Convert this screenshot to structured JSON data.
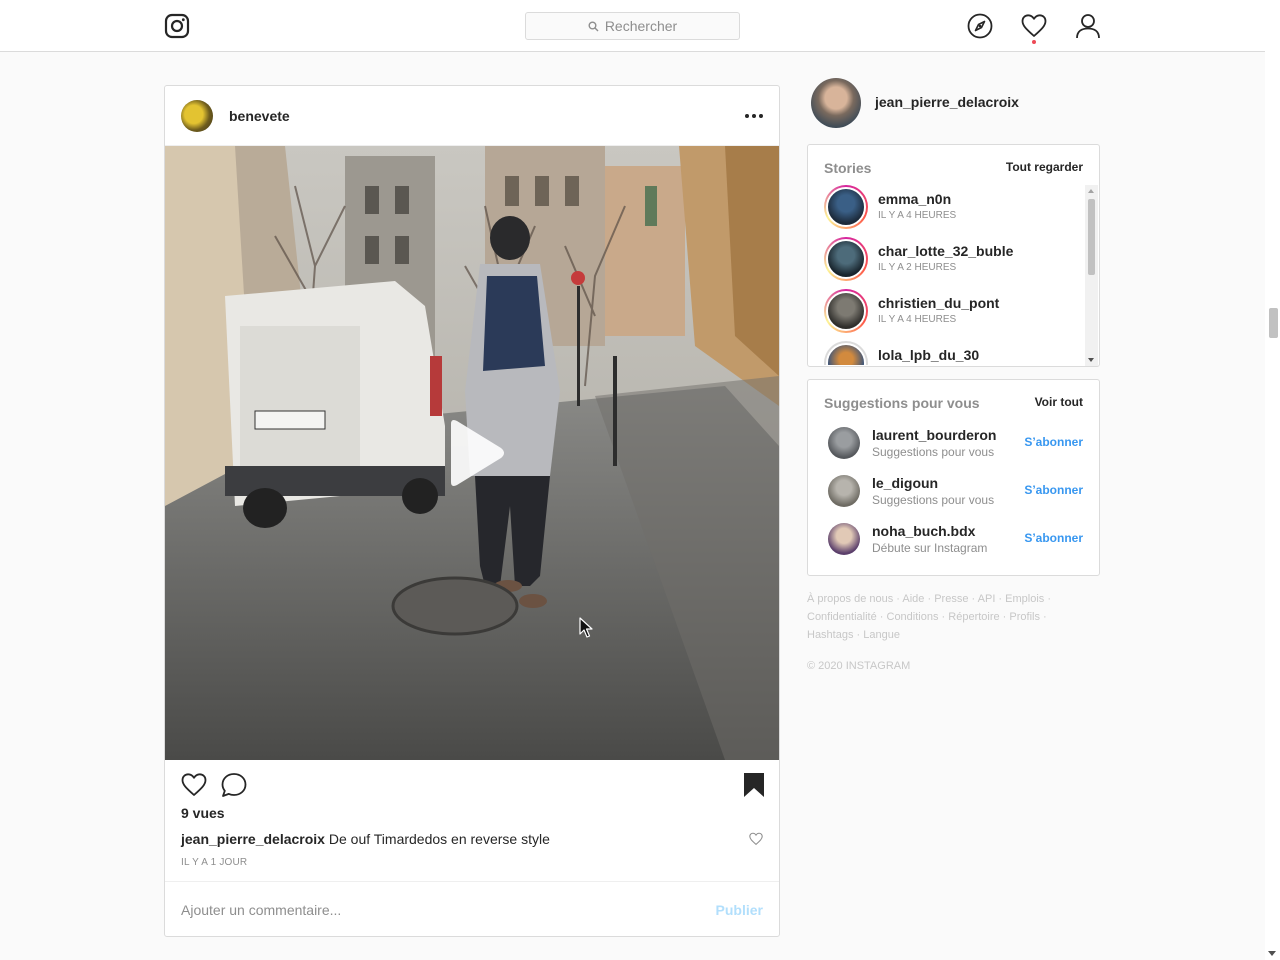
{
  "header": {
    "search_placeholder": "Rechercher",
    "icons": [
      "instagram-logo",
      "explore-compass-icon",
      "activity-heart-icon",
      "profile-icon"
    ]
  },
  "post": {
    "username": "benevete",
    "views": "9 vues",
    "caption_user": "jean_pierre_delacroix",
    "caption_text": "De ouf Timardedos en reverse style",
    "timestamp": "IL Y A 1 JOUR",
    "comment_placeholder": "Ajouter un commentaire...",
    "publish_label": "Publier",
    "media_type": "video",
    "saved": true
  },
  "sidebar": {
    "me": {
      "username": "jean_pierre_delacroix"
    },
    "stories": {
      "title": "Stories",
      "link": "Tout regarder",
      "items": [
        {
          "username": "emma_n0n",
          "time": "IL Y A 4 HEURES"
        },
        {
          "username": "char_lotte_32_buble",
          "time": "IL Y A 2 HEURES"
        },
        {
          "username": "christien_du_pont",
          "time": "IL Y A 4 HEURES"
        },
        {
          "username": "lola_lpb_du_30",
          "time": ""
        }
      ]
    },
    "suggestions": {
      "title": "Suggestions pour vous",
      "link": "Voir tout",
      "items": [
        {
          "username": "laurent_bourderon",
          "subtitle": "Suggestions pour vous",
          "action": "S’abonner"
        },
        {
          "username": "le_digoun",
          "subtitle": "Suggestions pour vous",
          "action": "S’abonner"
        },
        {
          "username": "noha_buch.bdx",
          "subtitle": "Débute sur Instagram",
          "action": "S’abonner"
        }
      ]
    },
    "footer_links": [
      "À propos de nous",
      "Aide",
      "Presse",
      "API",
      "Emplois",
      "Confidentialité",
      "Conditions",
      "Répertoire",
      "Profils",
      "Hashtags",
      "Langue"
    ],
    "copyright": "© 2020 INSTAGRAM"
  },
  "colors": {
    "link_blue": "#3897f0",
    "publish_disabled": "#b2dffc",
    "notification_dot": "#ed4956",
    "border": "#dbdbdb"
  }
}
